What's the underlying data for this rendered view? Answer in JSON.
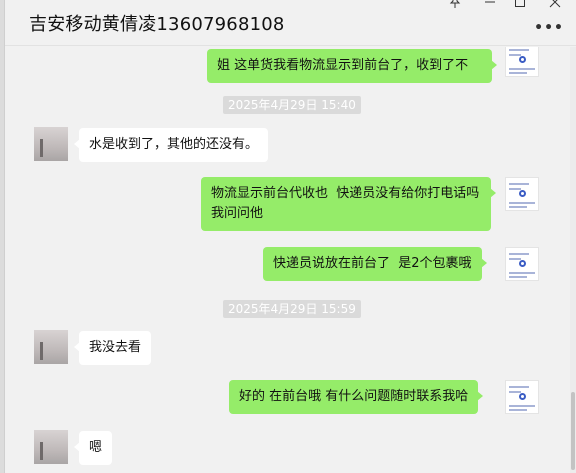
{
  "window": {
    "title": "吉安移动黄倩凌13607968108",
    "controls": [
      "pin",
      "minimize",
      "maximize",
      "close"
    ]
  },
  "messages": [
    {
      "type": "out",
      "text": "姐 这单货我看物流显示到前台了，收到了不"
    },
    {
      "type": "time",
      "text": "2025年4月29日 15:40"
    },
    {
      "type": "in",
      "text": "水是收到了，其他的还没有。"
    },
    {
      "type": "out",
      "text": "物流显示前台代收也  快递员没有给你打电话吗  我问问他"
    },
    {
      "type": "out",
      "text": "快递员说放在前台了  是2个包裹哦"
    },
    {
      "type": "time",
      "text": "2025年4月29日 15:59"
    },
    {
      "type": "in",
      "text": "我没去看"
    },
    {
      "type": "out",
      "text": "好的 在前台哦 有什么问题随时联系我哈"
    },
    {
      "type": "in",
      "text": "嗯"
    }
  ]
}
